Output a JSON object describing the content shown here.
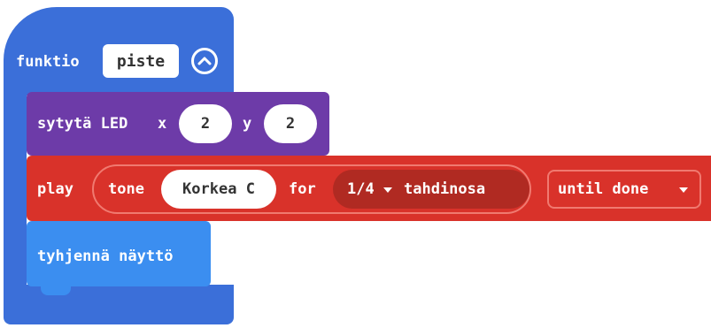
{
  "function_block": {
    "keyword": "funktio",
    "name": "piste"
  },
  "led_block": {
    "label": "sytytä LED",
    "x_label": "x",
    "x_value": "2",
    "y_label": "y",
    "y_value": "2"
  },
  "play_block": {
    "label": "play",
    "tone_label": "tone",
    "note": "Korkea C",
    "for_label": "for",
    "beat_value": "1/4",
    "beat_unit": "tahdinosa",
    "mode": "until done"
  },
  "clear_block": {
    "label": "tyhjennä näyttö"
  },
  "colors": {
    "function": "#3b6fd9",
    "led": "#6d3ba8",
    "music": "#d9322a",
    "basic": "#3b8ef0"
  }
}
